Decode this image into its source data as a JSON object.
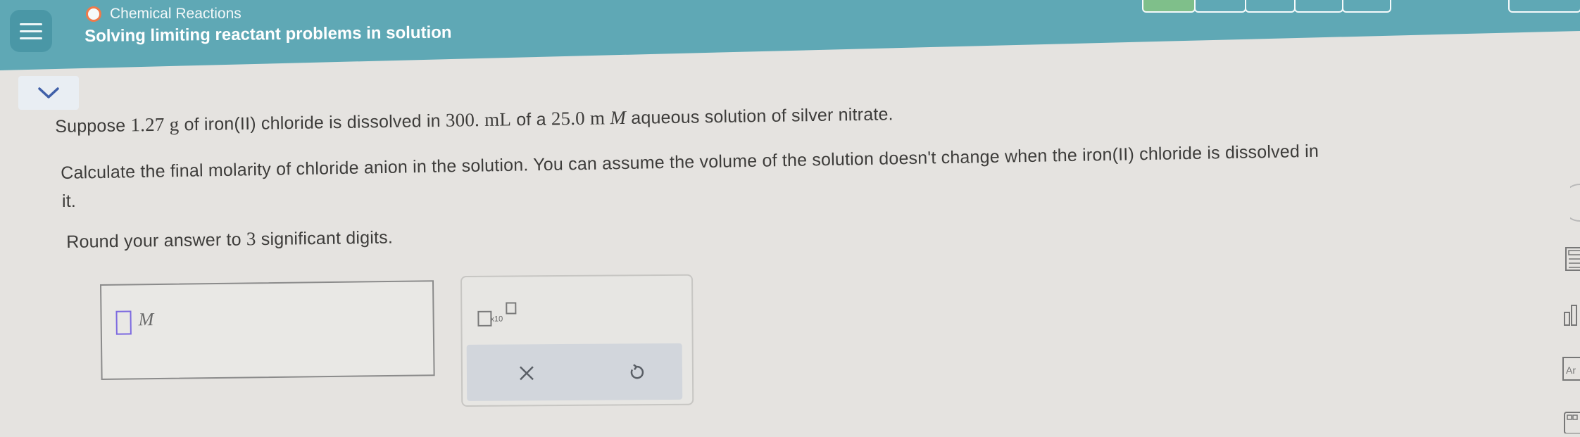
{
  "header": {
    "category": "Chemical Reactions",
    "title": "Solving limiting reactant problems in solution"
  },
  "question": {
    "line1_parts": [
      "Suppose ",
      "1.27",
      " ",
      "g",
      " of iron(II) chloride is dissolved in ",
      "300.",
      " ",
      "mL",
      " of a ",
      "25.0",
      " ",
      "m",
      " ",
      "M",
      " aqueous solution of silver nitrate."
    ],
    "line2": "Calculate the final molarity of chloride anion in the solution. You can assume the volume of the solution doesn't change when the iron(II) chloride is dissolved in",
    "line3": "it.",
    "line4_parts": [
      "Round your answer to ",
      "3",
      " significant digits."
    ]
  },
  "answer": {
    "value": "",
    "unit": "M"
  },
  "tools": {
    "sci_notation_label": "x10",
    "clear_icon": "x-icon",
    "undo_icon": "undo-icon"
  },
  "side_tools": {
    "element_label": "Ar"
  },
  "colors": {
    "header_bg": "#5fa8b5",
    "accent_orange": "#f07a4a",
    "input_cursor": "#7d6ae0"
  }
}
